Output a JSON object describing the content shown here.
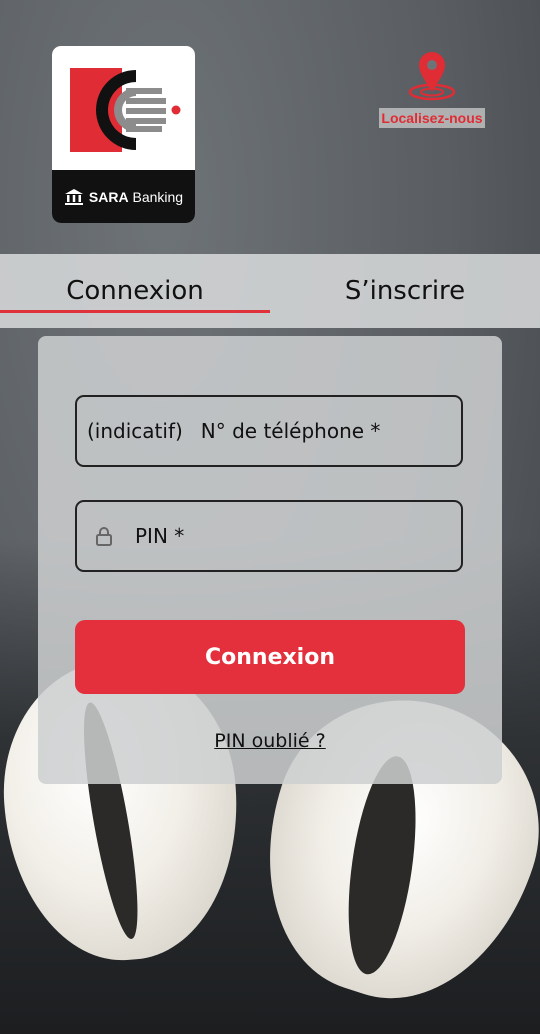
{
  "brand": {
    "name_bold": "SARA",
    "name_regular": " Banking",
    "colors": {
      "red": "#e02c34",
      "black": "#111111",
      "gray": "#8c8c8c"
    }
  },
  "locate": {
    "label": "Localisez-nous",
    "icon": "location-pin-icon"
  },
  "tabs": [
    {
      "label": "Connexion",
      "active": true
    },
    {
      "label": "S’inscrire",
      "active": false
    }
  ],
  "form": {
    "phone": {
      "prefix": "(indicatif)",
      "placeholder": "N° de téléphone *"
    },
    "pin": {
      "placeholder": "PIN *",
      "icon": "lock-icon"
    },
    "submit_label": "Connexion",
    "forgot_label": "PIN oublié ?"
  },
  "theme": {
    "accent": "#e3303c",
    "tab_underline": "#e0323a"
  }
}
